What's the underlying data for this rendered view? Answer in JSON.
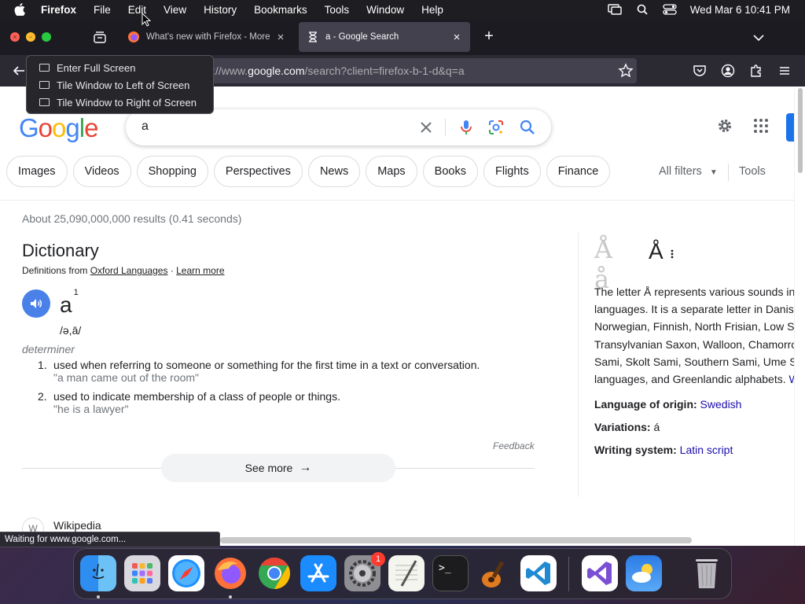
{
  "menubar": {
    "app_name": "Firefox",
    "items": [
      "File",
      "Edit",
      "View",
      "History",
      "Bookmarks",
      "Tools",
      "Window",
      "Help"
    ],
    "clock": "Wed Mar 6  10:41 PM"
  },
  "tabs": [
    {
      "title": "What's new with Firefox - More",
      "icon": "firefox-icon"
    },
    {
      "title": "a - Google Search",
      "icon": "hourglass-icon",
      "active": true
    }
  ],
  "urlbar": {
    "prefix": "://www.",
    "domain": "google.com",
    "path": "/search?client=firefox-b-1-d&q=a"
  },
  "window_menu": {
    "items": [
      "Enter Full Screen",
      "Tile Window to Left of Screen",
      "Tile Window to Right of Screen"
    ]
  },
  "search": {
    "query": "a"
  },
  "filters": {
    "chips": [
      "Images",
      "Videos",
      "Shopping",
      "Perspectives",
      "News",
      "Maps",
      "Books",
      "Flights",
      "Finance"
    ],
    "all_filters": "All filters",
    "tools": "Tools"
  },
  "results": {
    "stats": "About 25,090,000,000 results (0.41 seconds)"
  },
  "dictionary": {
    "title": "Dictionary",
    "source_prefix": "Definitions from ",
    "source": "Oxford Languages",
    "separator": " · ",
    "learn_more": "Learn more",
    "word": "a",
    "superscript": "1",
    "phonetic": "/ə,ā/",
    "part_of_speech": "determiner",
    "definitions": [
      {
        "num": "1.",
        "text": "used when referring to someone or something for the first time in a text or conversation.",
        "example": "\"a man came out of the room\""
      },
      {
        "num": "2.",
        "text": "used to indicate membership of a class of people or things.",
        "example": "\"he is a lawyer\""
      }
    ],
    "feedback": "Feedback",
    "see_more": "See more"
  },
  "wikipedia": {
    "title": "Wikipedia",
    "icon_text": "W"
  },
  "knowledge_panel": {
    "image_letters": "Å å",
    "title": "Å",
    "desc_lines": [
      "The letter Å represents various sounds in",
      "languages. It is a separate letter in Danish",
      "Norwegian, Finnish, North Frisian, Low S",
      "Transylvanian Saxon, Walloon, Chamorro",
      "Sami, Skolt Sami, Southern Sami, Ume S",
      "languages, and Greenlandic alphabets. "
    ],
    "desc_more": "W",
    "facts": [
      {
        "label": "Language of origin: ",
        "value": "Swedish",
        "link": true
      },
      {
        "label": "Variations: ",
        "value": "á",
        "link": false
      },
      {
        "label": "Writing system: ",
        "value": "Latin script",
        "link": true
      }
    ]
  },
  "status_text": "Waiting for www.google.com...",
  "dock": {
    "apps": [
      "finder-icon",
      "launchpad-icon",
      "safari-icon",
      "firefox-icon",
      "chrome-icon",
      "app-store-icon",
      "system-settings-icon",
      "textedit-icon",
      "terminal-icon",
      "garageband-icon",
      "vscode-icon",
      "visual-studio-icon",
      "weather-icon",
      "trash-icon"
    ],
    "settings_badge": "1"
  }
}
